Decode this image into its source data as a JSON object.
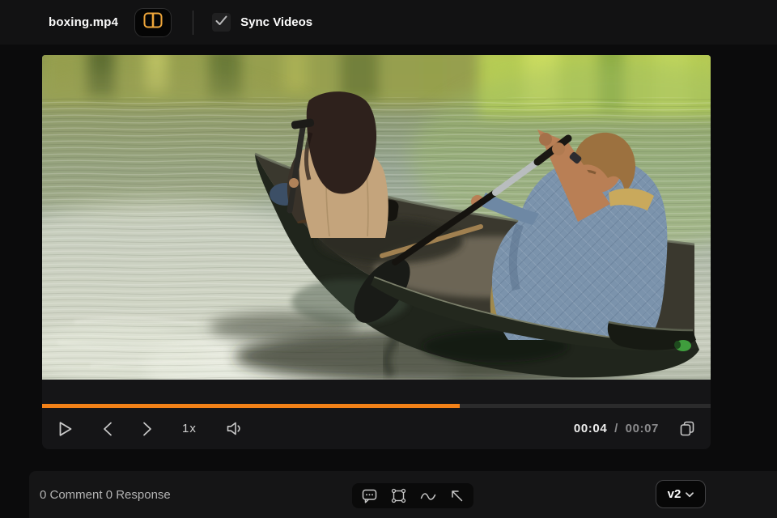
{
  "top_bar": {
    "filename": "boxing.mp4",
    "split_view_button": {
      "icon": "split-view-icon",
      "accent_color": "#efa63a"
    },
    "sync_checkbox": {
      "label": "Sync Videos",
      "checked": true
    }
  },
  "player": {
    "progress": {
      "percent": 62.5,
      "fill_color": "#f28118",
      "track_color": "#2b2b2c"
    },
    "controls": {
      "play_icon": "play-icon",
      "prev_icon": "chevron-left-icon",
      "next_icon": "chevron-right-icon",
      "speed_label": "1x",
      "volume_icon": "speaker-icon",
      "time_current": "00:04",
      "time_separator": "/",
      "time_duration": "00:07",
      "copy_icon": "copy-frame-icon"
    }
  },
  "comment_bar": {
    "summary": "0 Comment 0 Response",
    "tools": [
      "comment-tool-icon",
      "rect-tool-icon",
      "curve-tool-icon",
      "arrow-tool-icon"
    ],
    "version": {
      "label": "v2",
      "chevron": "chevron-down-icon"
    }
  },
  "video_scene": {
    "description": "Two people paddling a dark green canoe on a calm lake with yellow-green tree reflections"
  }
}
